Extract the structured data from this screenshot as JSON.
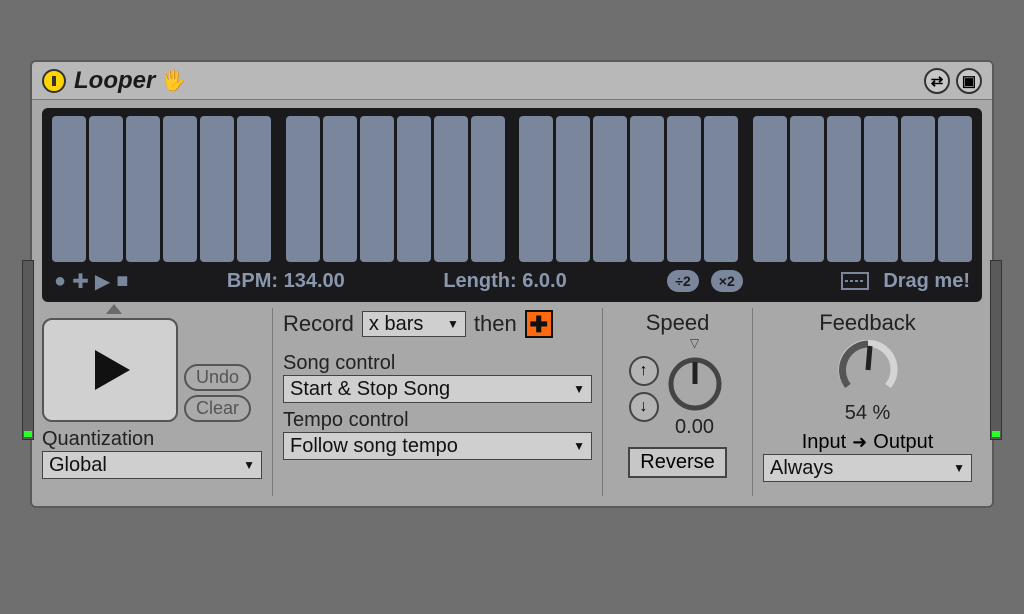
{
  "title": "Looper",
  "hand_icon": "✋",
  "display": {
    "bpm_label": "BPM: 134.00",
    "length_label": "Length: 6.0.0",
    "div2_label": "÷2",
    "mul2_label": "×2",
    "drag_label": "Drag me!",
    "bar_groups": 4,
    "bars_per_group": 6
  },
  "transport": {
    "undo_label": "Undo",
    "clear_label": "Clear"
  },
  "quantization": {
    "label": "Quantization",
    "value": "Global"
  },
  "record": {
    "label": "Record",
    "mode": "x bars",
    "then_label": "then"
  },
  "song_control": {
    "label": "Song control",
    "value": "Start & Stop Song"
  },
  "tempo_control": {
    "label": "Tempo control",
    "value": "Follow song tempo"
  },
  "speed": {
    "label": "Speed",
    "value": "0.00",
    "nudge_up": "↑",
    "nudge_down": "↓"
  },
  "reverse_label": "Reverse",
  "feedback": {
    "label": "Feedback",
    "value": "54 %"
  },
  "io": {
    "input_label": "Input",
    "output_label": "Output",
    "value": "Always"
  }
}
